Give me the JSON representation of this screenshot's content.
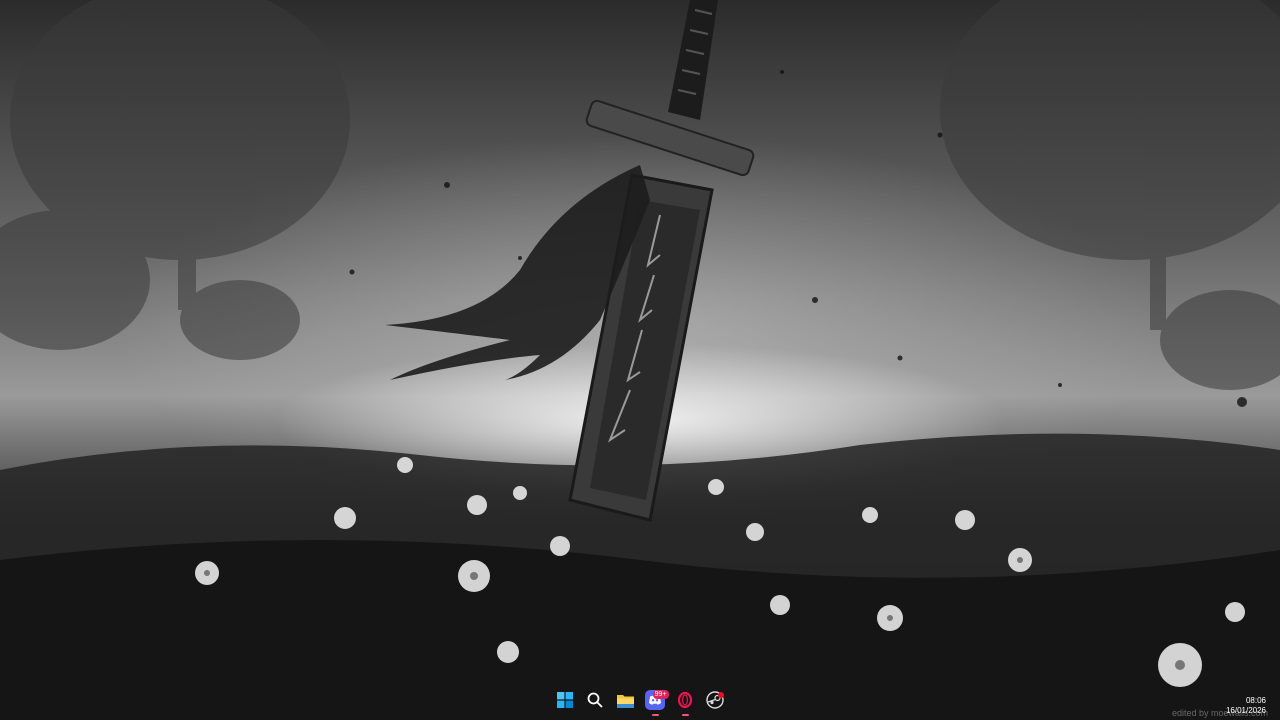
{
  "desktop": {
    "watermark": "edited by moewalls.com"
  },
  "taskbar": {
    "apps": [
      {
        "name": "start",
        "icon": "windows-start-icon"
      },
      {
        "name": "search",
        "icon": "search-icon"
      },
      {
        "name": "file-explorer",
        "icon": "folder-icon"
      },
      {
        "name": "discord",
        "icon": "discord-icon",
        "badge": "99+"
      },
      {
        "name": "opera-gx",
        "icon": "opera-gx-icon"
      },
      {
        "name": "steam",
        "icon": "steam-icon"
      }
    ],
    "discord_badge": "99+"
  },
  "clock": {
    "time": "08:06",
    "date": "16/01/2026"
  },
  "colors": {
    "accent": "#0078d4",
    "folder": "#f5c542",
    "discord": "#5865f2",
    "opera": "#e31b4a",
    "indicator": "#ff4f7a"
  }
}
